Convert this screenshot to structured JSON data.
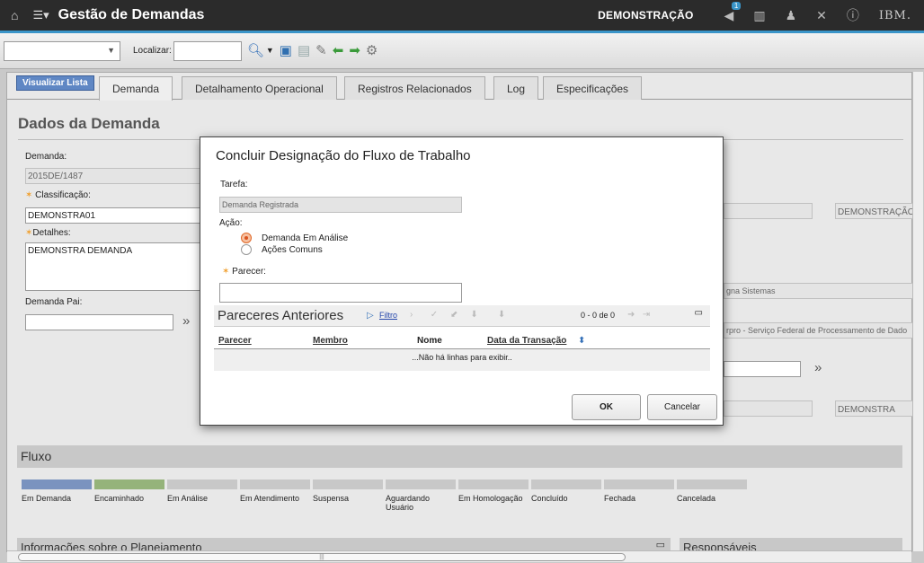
{
  "topbar": {
    "app_title": "Gestão de Demandas",
    "home_icon": "home-icon",
    "menu_icon": "menu-icon",
    "user_label": "DEMONSTRAÇÃO",
    "bulletin_count": "1",
    "ibm_logo": "IBM.",
    "icons": {
      "bulletin": "bulletin-board-icon",
      "reports": "reports-icon",
      "profile": "profile-icon",
      "tools": "tools-icon",
      "help": "help-icon"
    }
  },
  "toolbar": {
    "find_label": "Localizar:"
  },
  "tabs": {
    "list_view": "Visualizar Lista",
    "items": [
      "Demanda",
      "Detalhamento Operacional",
      "Registros Relacionados",
      "Log",
      "Especificações"
    ],
    "active": "Demanda"
  },
  "main": {
    "section_title": "Dados da Demanda",
    "demand_label": "Demanda:",
    "demand_value": "2015DE/1487",
    "classification_label": "Classificação:",
    "classification_value": "DEMONSTRA01",
    "details_label": "Detalhes:",
    "details_value": "DEMONSTRA DEMANDA",
    "parent_label": "Demanda Pai:",
    "right_value_1": "DEMONSTRAÇÃO",
    "right_value_2": "gna Sistemas",
    "right_value_3": "rpro - Serviço Federal de Processamento de Dado",
    "right_value_4": "DEMONSTRA"
  },
  "flow": {
    "title": "Fluxo",
    "stages": [
      "Em Demanda",
      "Encaminhado",
      "Em Análise",
      "Em Atendimento",
      "Suspensa",
      "Aguardando Usuário",
      "Em Homologação",
      "Concluído",
      "Fechada",
      "Cancelada"
    ],
    "colors": {
      "done": "#7a93bf",
      "current": "#95b37a",
      "pending": "#c8c8c8"
    }
  },
  "bottom": {
    "planning_title": "Informações sobre o Planejamento",
    "responsible_title": "Responsáveis"
  },
  "dialog": {
    "title": "Concluir Designação do Fluxo de Trabalho",
    "task_label": "Tarefa:",
    "task_value": "Demanda Registrada",
    "action_label": "Ação:",
    "options": [
      "Demanda Em Análise",
      "Ações Comuns"
    ],
    "selected_option": "Demanda Em Análise",
    "opinion_label": "Parecer:",
    "opinion_value": "",
    "grid": {
      "title": "Pareceres Anteriores",
      "filter_label": "Filtro",
      "pager": "0 - 0 de 0",
      "columns": [
        "Parecer",
        "Membro",
        "Nome",
        "Data da Transação"
      ],
      "empty_text": "...Não há linhas para exibir.."
    },
    "ok_label": "OK",
    "cancel_label": "Cancelar"
  }
}
